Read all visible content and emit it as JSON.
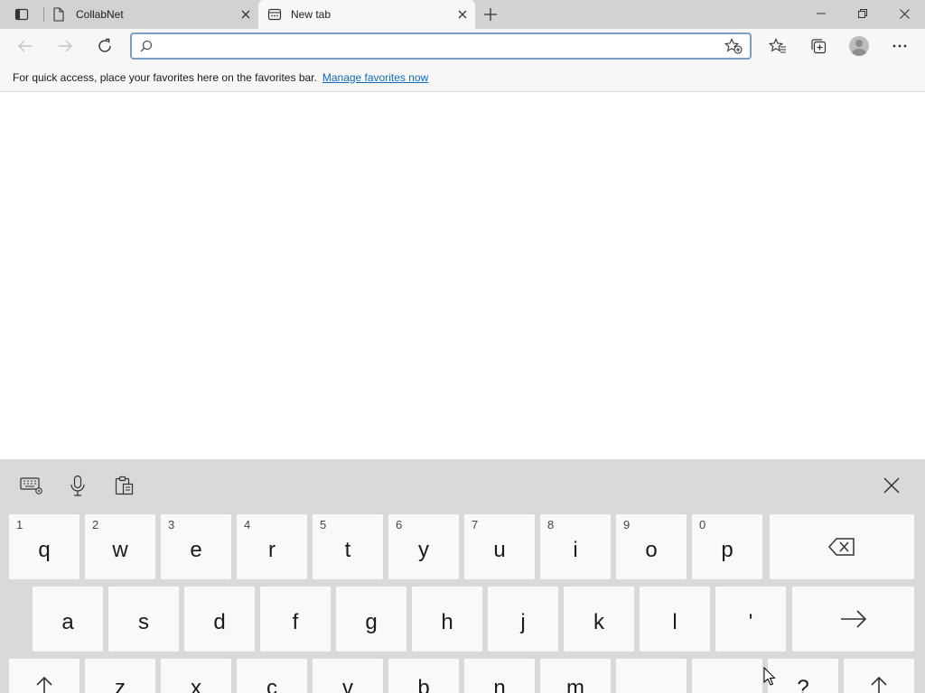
{
  "tabs": [
    {
      "title": "CollabNet",
      "icon": "page-icon",
      "active": false
    },
    {
      "title": "New tab",
      "icon": "newtab-icon",
      "active": true
    }
  ],
  "toolbar": {
    "address_value": "",
    "address_placeholder": ""
  },
  "favorites_bar": {
    "message": "For quick access, place your favorites here on the favorites bar.",
    "link": "Manage favorites now"
  },
  "keyboard": {
    "row1": [
      {
        "sub": "1",
        "label": "q"
      },
      {
        "sub": "2",
        "label": "w"
      },
      {
        "sub": "3",
        "label": "e"
      },
      {
        "sub": "4",
        "label": "r"
      },
      {
        "sub": "5",
        "label": "t"
      },
      {
        "sub": "6",
        "label": "y"
      },
      {
        "sub": "7",
        "label": "u"
      },
      {
        "sub": "8",
        "label": "i"
      },
      {
        "sub": "9",
        "label": "o"
      },
      {
        "sub": "0",
        "label": "p"
      }
    ],
    "row2": [
      {
        "label": "a"
      },
      {
        "label": "s"
      },
      {
        "label": "d"
      },
      {
        "label": "f"
      },
      {
        "label": "g"
      },
      {
        "label": "h"
      },
      {
        "label": "j"
      },
      {
        "label": "k"
      },
      {
        "label": "l"
      },
      {
        "label": "'"
      }
    ],
    "row3": [
      {
        "label": "z"
      },
      {
        "label": "x"
      },
      {
        "label": "c"
      },
      {
        "label": "v"
      },
      {
        "label": "b"
      },
      {
        "label": "n"
      },
      {
        "label": "m"
      },
      {
        "label": ""
      },
      {
        "label": ""
      },
      {
        "label": "?"
      }
    ]
  }
}
